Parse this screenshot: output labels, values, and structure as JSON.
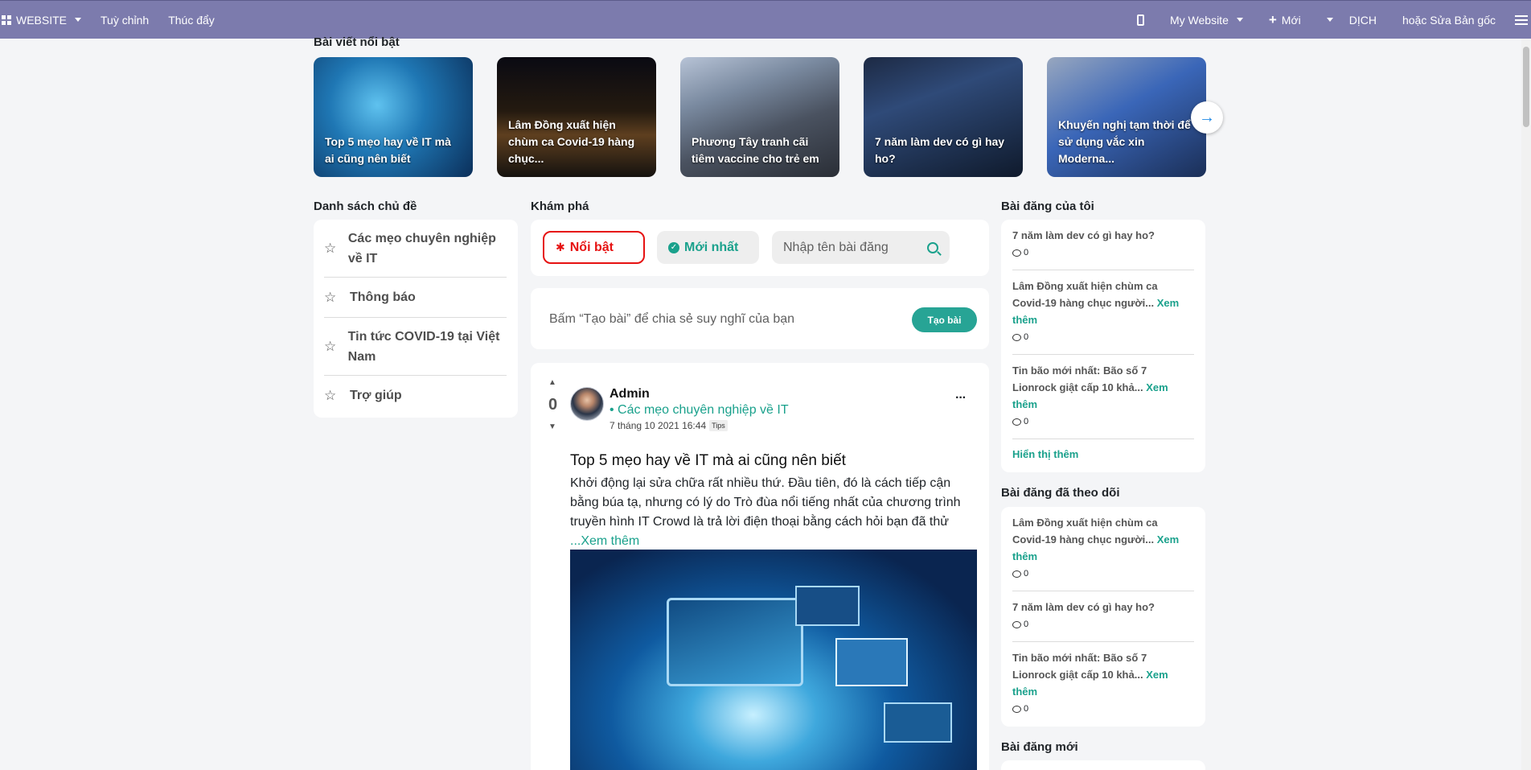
{
  "topbar": {
    "website_label": "WEBSITE",
    "customize": "Tuỳ chỉnh",
    "promote": "Thúc đẩy",
    "site_name": "My Website",
    "new_label": "Mới",
    "translate": "DỊCH",
    "edit_original": "hoặc Sửa Bản gốc"
  },
  "featured": {
    "title": "Bài viết nổi bật",
    "items": [
      "Top 5 mẹo hay về IT mà ai cũng nên biết",
      "Lâm Đồng xuất hiện chùm ca Covid-19 hàng chục...",
      "Phương Tây tranh cãi tiêm vaccine cho trẻ em",
      "7 năm làm dev có gì hay ho?",
      "Khuyến nghị tạm thời để sử dụng vắc xin Moderna..."
    ]
  },
  "topics": {
    "title": "Danh sách chủ đề",
    "items": [
      "Các mẹo chuyên nghiệp về IT",
      "Thông báo",
      "Tin tức COVID-19 tại Việt Nam",
      "Trợ giúp"
    ]
  },
  "explore": {
    "title": "Khám phá",
    "hot": "Nổi bật",
    "newest": "Mới nhất",
    "search_placeholder": "Nhập tên bài đăng",
    "create_prompt": "Bấm “Tạo bài” để chia sẻ suy nghĩ của bạn",
    "create_button": "Tạo bài"
  },
  "post": {
    "votes": "0",
    "author": "Admin",
    "category": "• Các mẹo chuyên nghiệp về IT",
    "date": "7 tháng 10 2021 16:44",
    "tag": "Tips",
    "title": "Top 5 mẹo hay về IT mà ai cũng nên biết",
    "excerpt": "Khởi động lại sửa chữa rất nhiều thứ. Đầu tiên, đó là cách tiếp cận bằng búa tạ, nhưng có lý do Trò đùa nổi tiếng nhất của chương trình truyền hình IT Crowd là trả lời điện thoại bằng cách hỏi bạn đã thử",
    "read_more": "...Xem thêm"
  },
  "my_posts": {
    "title": "Bài đăng của tôi",
    "items": [
      {
        "title": "7 năm làm dev có gì hay ho?",
        "more": "",
        "count": "0"
      },
      {
        "title": "Lâm Đồng xuất hiện chùm ca Covid-19 hàng chục người...",
        "more": "Xem thêm",
        "count": "0"
      },
      {
        "title": "Tin bão mới nhất: Bão số 7 Lionrock giật cấp 10 khả...",
        "more": "Xem thêm",
        "count": "0"
      }
    ],
    "show_more": "Hiển thị thêm"
  },
  "followed": {
    "title": "Bài đăng đã theo dõi",
    "items": [
      {
        "title": "Lâm Đồng xuất hiện chùm ca Covid-19 hàng chục người...",
        "more": "Xem thêm",
        "count": "0"
      },
      {
        "title": "7 năm làm dev có gì hay ho?",
        "more": "",
        "count": "0"
      },
      {
        "title": "Tin bão mới nhất: Bão số 7 Lionrock giật cấp 10 khả...",
        "more": "Xem thêm",
        "count": "0"
      }
    ]
  },
  "new_posts": {
    "title": "Bài đăng mới"
  }
}
